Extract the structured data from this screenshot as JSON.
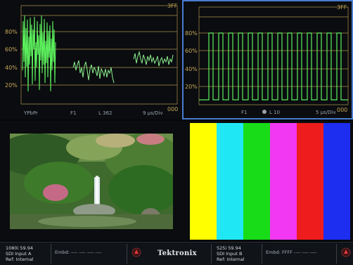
{
  "waveform_left": {
    "top_right_label": "3FF",
    "bottom_right_label": "000",
    "grid_labels": [
      "80%",
      "60%",
      "40%",
      "20%"
    ],
    "footer": [
      "YPbPr",
      "F1",
      "L 362",
      "9 µs/Div"
    ]
  },
  "waveform_right": {
    "top_right_label": "3FF",
    "bottom_right_label": "000",
    "grid_labels": [
      "80%",
      "60%",
      "40%",
      "20%"
    ],
    "footer": [
      "F1",
      "L 10",
      "5 µs/Div"
    ]
  },
  "color_bars": {
    "colors": [
      "#ffff00",
      "#1fe8f4",
      "#17dc17",
      "#f238f2",
      "#ee1c1c",
      "#1d2ef0"
    ]
  },
  "status_bar": {
    "input_a": {
      "format": "1080i 59.94",
      "input": "SDI Input A",
      "ref": "Ref: Internal",
      "embd": "Embd: ---- ---- ---- ----"
    },
    "input_b": {
      "format": "525i 59.94",
      "input": "SDI Input B",
      "ref": "Ref: Internal",
      "embd": "Embd: FFFF ---- ---- ----"
    },
    "logo": "Tektronix"
  },
  "colors": {
    "trace": "#5cf05c",
    "graticule": "#c9a95a",
    "selection": "#4a7bd0"
  }
}
